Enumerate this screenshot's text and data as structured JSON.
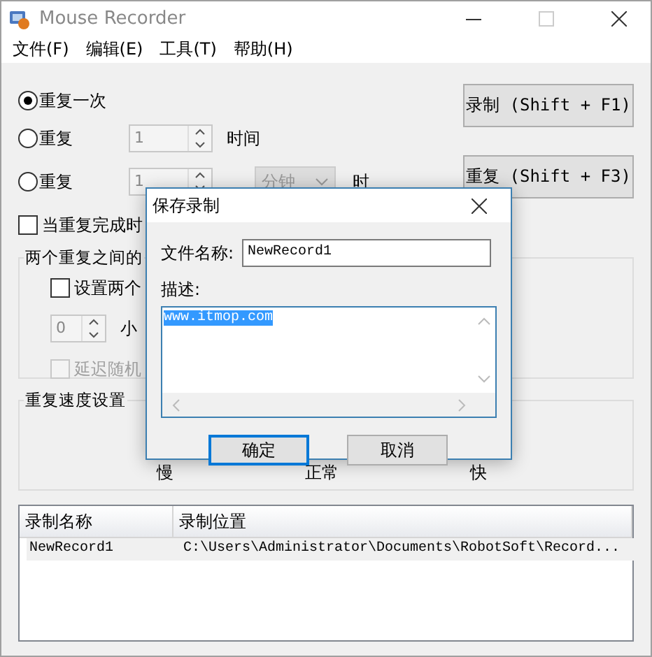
{
  "window": {
    "title": "Mouse Recorder"
  },
  "menu": [
    {
      "label": "文件(F)"
    },
    {
      "label": "编辑(E)"
    },
    {
      "label": "工具(T)"
    },
    {
      "label": "帮助(H)"
    }
  ],
  "repeat_options": [
    {
      "label": "重复一次",
      "selected": true
    },
    {
      "label": "重复",
      "selected": false,
      "spinner": "1",
      "unit": "时间"
    },
    {
      "label": "重复",
      "selected": false,
      "spinner": "1",
      "dropdown": "分钟",
      "unit": "时"
    }
  ],
  "buttons": [
    {
      "label": "录制 (Shift + F1)"
    },
    {
      "label": "重复 (Shift + F3)"
    }
  ],
  "on_complete_checkbox": {
    "label": "当重复完成时",
    "checked": false
  },
  "interval_group": {
    "title": "两个重复之间的",
    "checkbox": {
      "label": "设置两个",
      "checked": false
    },
    "spinner": "0",
    "unit": "小",
    "random_checkbox": {
      "label": "延迟随机",
      "checked": false,
      "disabled": true
    }
  },
  "speed_group": {
    "title": "重复速度设置",
    "labels": [
      "慢",
      "正常",
      "快"
    ]
  },
  "table": {
    "columns": [
      "录制名称",
      "录制位置"
    ],
    "rows": [
      {
        "cells": [
          "NewRecord1",
          "C:\\Users\\Administrator\\Documents\\RobotSoft\\Record..."
        ],
        "selected": true
      }
    ]
  },
  "dialog": {
    "title": "保存录制",
    "name_label": "文件名称:",
    "name_value": "NewRecord1",
    "description_label": "描述:",
    "description_value": "www.itmop.com",
    "buttons": [
      {
        "label": "确定",
        "focused": true
      },
      {
        "label": "取消",
        "focused": false
      }
    ]
  }
}
